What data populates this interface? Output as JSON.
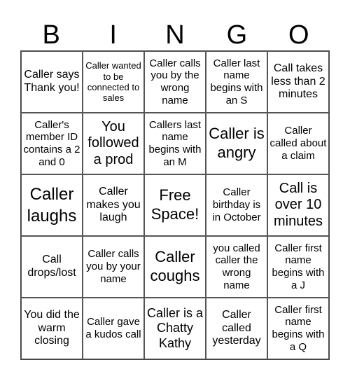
{
  "header": [
    "B",
    "I",
    "N",
    "G",
    "O"
  ],
  "cells": [
    "Caller says Thank you!",
    "Caller wanted to be connected to sales",
    "Caller calls you by the wrong name",
    "Caller last name begins with an S",
    "Call takes less than 2 minutes",
    "Caller's member ID contains a 2 and 0",
    "You followed a prod",
    "Callers last name begins with an M",
    "Caller is angry",
    "Caller called about a claim",
    "Caller laughs",
    "Caller makes you laugh",
    "Free Space!",
    "Caller birthday is in October",
    "Call is over 10 minutes",
    "Call drops/lost",
    "Caller calls you by your name",
    "Caller coughs",
    "you called caller the wrong name",
    "Caller first name begins with a J",
    "You did the warm closing",
    "Caller gave a kudos call",
    "Caller is a Chatty Kathy",
    "Caller called yesterday",
    "Caller first name begins with a Q"
  ]
}
